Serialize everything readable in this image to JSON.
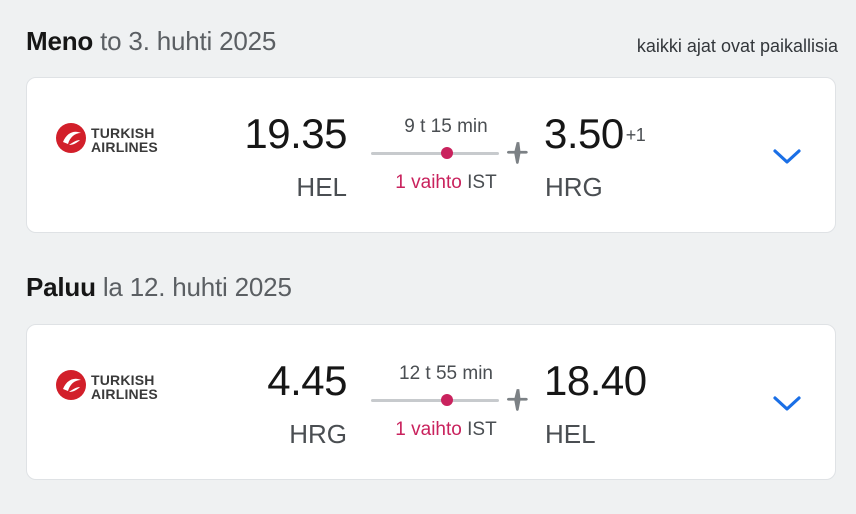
{
  "timezone_note": "kaikki ajat ovat paikallisia",
  "colors": {
    "accent": "#c9225d",
    "chevron": "#1a6fe6",
    "airline_red": "#d21f2a"
  },
  "legs": [
    {
      "label": "Meno",
      "date": "to 3. huhti 2025",
      "airline": {
        "name_line1": "TURKISH",
        "name_line2": "AIRLINES",
        "logo_icon": "turkish-airlines-logo"
      },
      "departure": {
        "time": "19.35",
        "code": "HEL"
      },
      "arrival": {
        "time": "3.50",
        "day_offset": "+1",
        "code": "HRG"
      },
      "duration": "9 t 15 min",
      "stops": "1 vaihto",
      "via": "IST"
    },
    {
      "label": "Paluu",
      "date": "la 12. huhti 2025",
      "airline": {
        "name_line1": "TURKISH",
        "name_line2": "AIRLINES",
        "logo_icon": "turkish-airlines-logo"
      },
      "departure": {
        "time": "4.45",
        "code": "HRG"
      },
      "arrival": {
        "time": "18.40",
        "day_offset": "",
        "code": "HEL"
      },
      "duration": "12 t 55 min",
      "stops": "1 vaihto",
      "via": "IST"
    }
  ]
}
